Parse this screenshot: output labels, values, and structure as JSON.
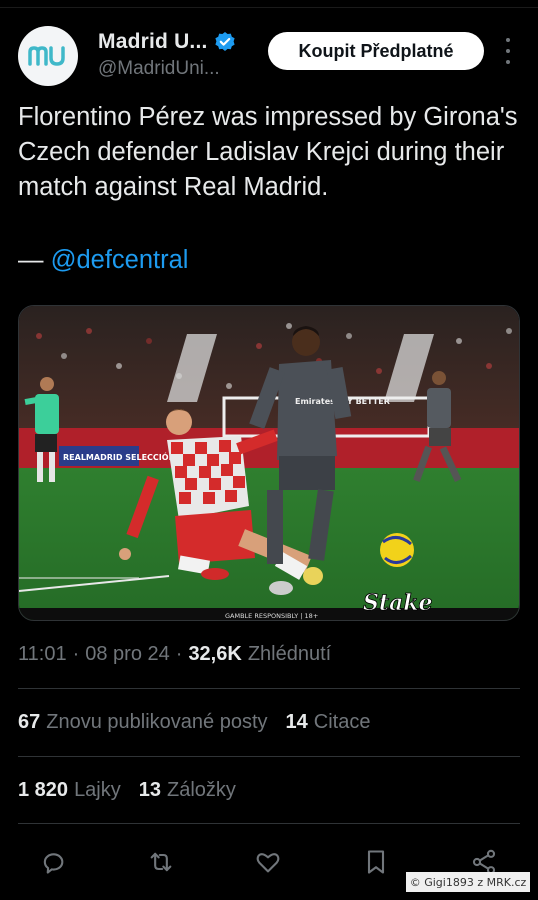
{
  "author": {
    "display_name": "Madrid U...",
    "handle": "@MadridUni...",
    "avatar_text": "mu",
    "verified": true
  },
  "header": {
    "subscribe_label": "Koupit Předplatné"
  },
  "tweet": {
    "text": "Florentino Pérez was impressed by Girona's Czech defender Ladislav Krejci during their match against Real Madrid.",
    "attribution_prefix": "— ",
    "attribution_mention": "@defcentral"
  },
  "media": {
    "type": "photo",
    "description_tags": [
      "football",
      "stadium",
      "tackle"
    ],
    "overlay_text": "GAMBLE RESPONSIBLY | 18+",
    "brand_logo_text": "Stake",
    "board_text": "REALMADRID SELECCIÓN",
    "shirt_sponsor": "Emirates FLY BETTER"
  },
  "meta": {
    "time": "11:01",
    "date": "08 pro 24",
    "views_count": "32,6K",
    "views_label": "Zhlédnutí"
  },
  "stats": {
    "reposts_count": "67",
    "reposts_label": "Znovu publikované posty",
    "quotes_count": "14",
    "quotes_label": "Citace",
    "likes_count": "1 820",
    "likes_label": "Lajky",
    "bookmarks_count": "13",
    "bookmarks_label": "Záložky"
  },
  "actions": {
    "reply_icon": "reply-icon",
    "repost_icon": "repost-icon",
    "like_icon": "heart-icon",
    "bookmark_icon": "bookmark-icon",
    "share_icon": "share-icon"
  },
  "watermark": "© Gigi1893 z MRK.cz",
  "colors": {
    "background": "#000000",
    "text_primary": "#e7e9ea",
    "text_secondary": "#71767b",
    "link": "#1d9bf0",
    "verified_blue": "#1d9bf0",
    "divider": "#2f3336"
  }
}
